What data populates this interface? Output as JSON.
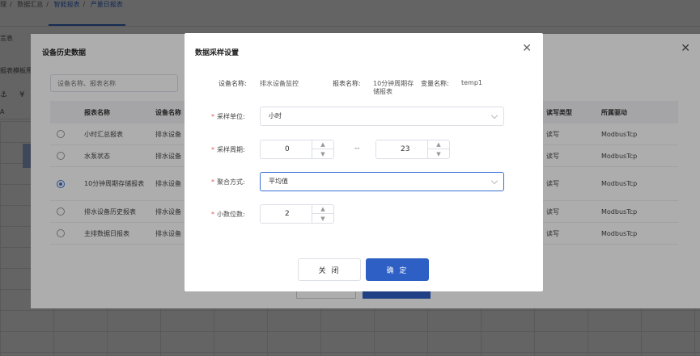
{
  "breadcrumb": [
    "理",
    "数据汇总",
    "智能报表",
    "产量日报表"
  ],
  "background": {
    "tab_label": "言息",
    "template_label": "报表模板用于",
    "toolbar_icons": [
      "format-painter-icon",
      "currency-icon",
      "dropdown-icon",
      "clear-icon"
    ],
    "sheet_col": "A"
  },
  "history_dialog": {
    "title": "设备历史数据",
    "search_placeholder": "设备名称、报表名称",
    "columns": [
      "报表名称",
      "设备名称",
      "读写类型",
      "所属驱动"
    ],
    "rows": [
      {
        "report": "小时汇总报表",
        "device": "排水设备",
        "rw": "读写",
        "driver": "ModbusTcp",
        "selected": false
      },
      {
        "report": "水泵状态",
        "device": "排水设备",
        "rw": "读写",
        "driver": "ModbusTcp",
        "selected": false
      },
      {
        "report": "10分钟周期存储报表",
        "device": "排水设备",
        "rw": "读写",
        "driver": "ModbusTcp",
        "selected": true
      },
      {
        "report": "排水设备历史报表",
        "device": "排水设备",
        "rw": "读写",
        "driver": "ModbusTcp",
        "selected": false
      },
      {
        "report": "主排数据日报表",
        "device": "排水设备",
        "rw": "读写",
        "driver": "ModbusTcp",
        "selected": false
      }
    ]
  },
  "sampling_dialog": {
    "title": "数据采样设置",
    "info": {
      "device_label": "设备名称:",
      "device_value": "排水设备监控",
      "report_label": "报表名称:",
      "report_value_line1": "10分钟周期存",
      "report_value_line2": "储报表",
      "variable_label": "变量名称:",
      "variable_value": "temp1"
    },
    "form": {
      "unit_label": "采样单位:",
      "unit_value": "小时",
      "period_label": "采样周期:",
      "period_start": "0",
      "period_sep": "--",
      "period_end": "23",
      "agg_label": "聚合方式:",
      "agg_value": "平均值",
      "decimal_label": "小数位数:",
      "decimal_value": "2"
    },
    "buttons": {
      "close": "关 闭",
      "confirm": "确 定"
    }
  },
  "colors": {
    "primary": "#2e5fc4",
    "required": "#e25757",
    "focus_border": "#3a6fd6"
  }
}
